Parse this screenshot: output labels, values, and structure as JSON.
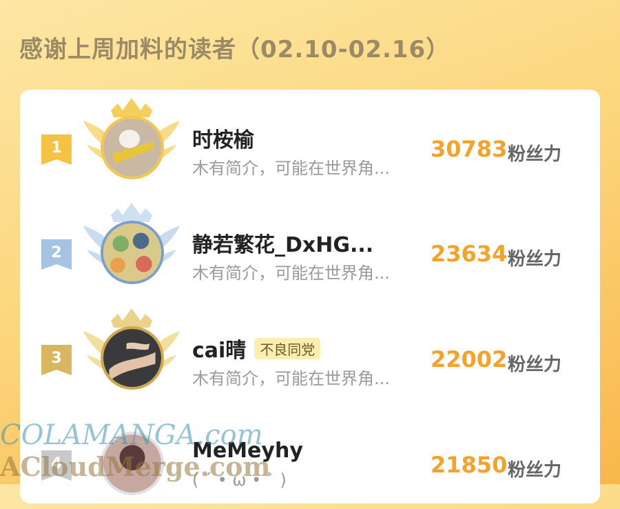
{
  "header": {
    "title": "感谢上周加料的读者（02.10-02.16）"
  },
  "colors": {
    "gold": "#f4c64b",
    "silver": "#a7c3e3",
    "bronze": "#d7b860",
    "score": "#f4a229"
  },
  "readers": [
    {
      "rank": "1",
      "name": "时桉榆",
      "tag": "",
      "intro": "木有简介，可能在世界角...",
      "score": "30783",
      "unit": "粉丝力"
    },
    {
      "rank": "2",
      "name": "静若繁花_DxHG...",
      "tag": "",
      "intro": "木有简介，可能在世界角...",
      "score": "23634",
      "unit": "粉丝力"
    },
    {
      "rank": "3",
      "name": "cai晴",
      "tag": "不良同党",
      "intro": "木有简介，可能在世界角...",
      "score": "22002",
      "unit": "粉丝力"
    },
    {
      "rank": "4",
      "name": "MeMeyhy",
      "tag": "",
      "intro": "( ´ • ω • ` )",
      "score": "21850",
      "unit": "粉丝力"
    }
  ],
  "watermark": {
    "line1": "COLAMANGA.com",
    "line2": "ACloudMerge.com"
  }
}
